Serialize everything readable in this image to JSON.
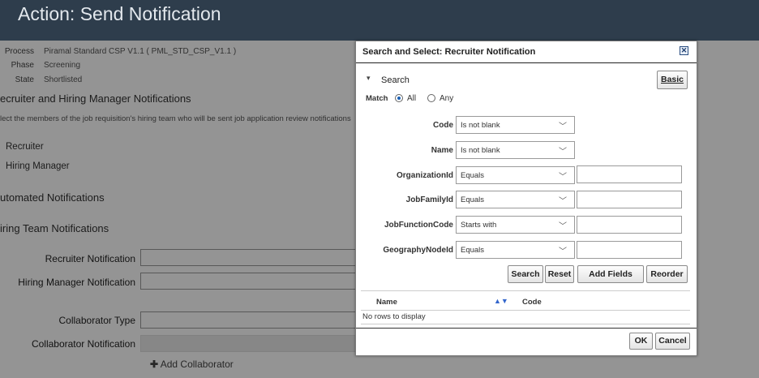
{
  "header": {
    "title": "Action: Send Notification"
  },
  "details": [
    {
      "label": "Process",
      "value": "Piramal Standard CSP V1.1 ( PML_STD_CSP_V1.1 )"
    },
    {
      "label": "Phase",
      "value": "Screening"
    },
    {
      "label": "State",
      "value": "Shortlisted"
    }
  ],
  "sections": {
    "recruiter_hm": "ecruiter and Hiring Manager Notifications",
    "instructions": "lect the members of the job requisition's hiring team who will be sent job application review notifications",
    "recruiter_row": "Recruiter",
    "hm_row": "Hiring Manager",
    "automated": "utomated Notifications",
    "hiring_team": "iring Team Notifications"
  },
  "form": {
    "recruiter_notification": "Recruiter Notification",
    "hm_notification": "Hiring Manager Notification",
    "collaborator_type": "Collaborator Type",
    "collaborator_notification": "Collaborator Notification",
    "add_collaborator": "Add Collaborator"
  },
  "dialog": {
    "title": "Search and Select: Recruiter Notification",
    "close_symbol": "✕",
    "search_heading": "Search",
    "basic_button": "Basic",
    "match_label": "Match",
    "match_options": [
      "All",
      "Any"
    ],
    "match_selected": "All",
    "criteria": [
      {
        "label": "Code",
        "operator": "Is not blank",
        "has_value_field": false
      },
      {
        "label": "Name",
        "operator": "Is not blank",
        "has_value_field": false
      },
      {
        "label": "OrganizationId",
        "operator": "Equals",
        "has_value_field": true,
        "value": ""
      },
      {
        "label": "JobFamilyId",
        "operator": "Equals",
        "has_value_field": true,
        "value": ""
      },
      {
        "label": "JobFunctionCode",
        "operator": "Starts with",
        "has_value_field": true,
        "value": ""
      },
      {
        "label": "GeographyNodeId",
        "operator": "Equals",
        "has_value_field": true,
        "value": ""
      }
    ],
    "buttons": {
      "search": "Search",
      "reset": "Reset",
      "add_fields": "Add Fields",
      "reorder": "Reorder"
    },
    "table": {
      "columns": [
        "Name",
        "Code"
      ],
      "sort_icons": "▲▼",
      "empty_message": "No rows to display"
    },
    "footer": {
      "ok": "OK",
      "cancel": "Cancel"
    }
  },
  "colors": {
    "header_bg": "#2e3d4c",
    "overlay": "rgba(0,0,0,0.42)",
    "radio_accent": "#1a5fb4"
  }
}
